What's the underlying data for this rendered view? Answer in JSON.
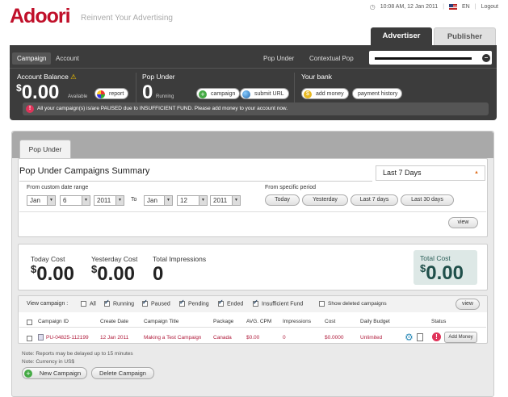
{
  "brand": {
    "logo": "Adoori",
    "tagline": "Reinvent Your Advertising"
  },
  "topbar": {
    "datetime": "10:08 AM, 12 Jan 2011",
    "language": "EN",
    "logout": "Logout"
  },
  "role_tabs": {
    "advertiser": "Advertiser",
    "publisher": "Publisher"
  },
  "nav": {
    "campaign": "Campaign",
    "account": "Account",
    "pop_under": "Pop Under",
    "contextual_pop": "Contextual Pop"
  },
  "account_panel": {
    "balance_label": "Account Balance",
    "currency_symbol": "$",
    "balance_value": "0.00",
    "available_label": "Available",
    "report_button": "report"
  },
  "popunder_panel": {
    "label": "Pop Under",
    "running_count": "0",
    "running_label": "Running",
    "campaign_button": "campaign",
    "submit_url_button": "submit URL"
  },
  "bank_panel": {
    "label": "Your bank",
    "add_money_button": "add money",
    "payment_history_button": "payment history"
  },
  "alert": "All your campaign(s) is/are PAUSED due to INSUFFICIENT FUND. Please add money to your account now.",
  "content_tab": "Pop Under",
  "summary": {
    "title": "Pop Under Campaigns Summary",
    "period_selected": "Last 7 Days",
    "custom_range_label": "From custom date range",
    "from": {
      "month": "Jan",
      "day": "6",
      "year": "2011"
    },
    "to_label": "To",
    "to": {
      "month": "Jan",
      "day": "12",
      "year": "2011"
    },
    "specific_period_label": "From specific period",
    "period_buttons": [
      "Today",
      "Yesterday",
      "Last 7 days",
      "Last 30 days"
    ],
    "view_button": "view"
  },
  "costs": {
    "today_label": "Today Cost",
    "today_value": "0.00",
    "yesterday_label": "Yesterday Cost",
    "yesterday_value": "0.00",
    "impressions_label": "Total Impressions",
    "impressions_value": "0",
    "total_label": "Total Cost",
    "total_value": "0.00",
    "currency_symbol": "$"
  },
  "filters": {
    "label": "View campaign :",
    "options": [
      {
        "label": "All",
        "checked": false
      },
      {
        "label": "Running",
        "checked": true
      },
      {
        "label": "Paused",
        "checked": true
      },
      {
        "label": "Pending",
        "checked": true
      },
      {
        "label": "Ended",
        "checked": true
      },
      {
        "label": "Insufficient Fund",
        "checked": true
      }
    ],
    "show_deleted": "Show deleted campaigns",
    "view_button": "view"
  },
  "table": {
    "headers": [
      "Campaign ID",
      "Create Date",
      "Campaign Title",
      "Package",
      "AVG. CPM",
      "Impressions",
      "Cost",
      "Daily Budget",
      "Status"
    ],
    "rows": [
      {
        "id": "PU-04825-112199",
        "date": "12 Jan 2011",
        "title": "Making a Test Campaign",
        "package": "Canada",
        "cpm": "$0.00",
        "impressions": "0",
        "cost": "$0.0000",
        "budget": "Unlimited",
        "action": "Add Money"
      }
    ]
  },
  "notes": [
    "Note: Reports may be delayed up to 15 minutes",
    "Note: Currency in US$"
  ],
  "actions": {
    "new_campaign": "New Campaign",
    "delete_campaign": "Delete Campaign"
  },
  "colors": {
    "brand_red": "#c0102a",
    "dark_bar": "#3c3c3c",
    "alert_pink": "#e0345a",
    "total_cost_text": "#1f4f4a"
  }
}
